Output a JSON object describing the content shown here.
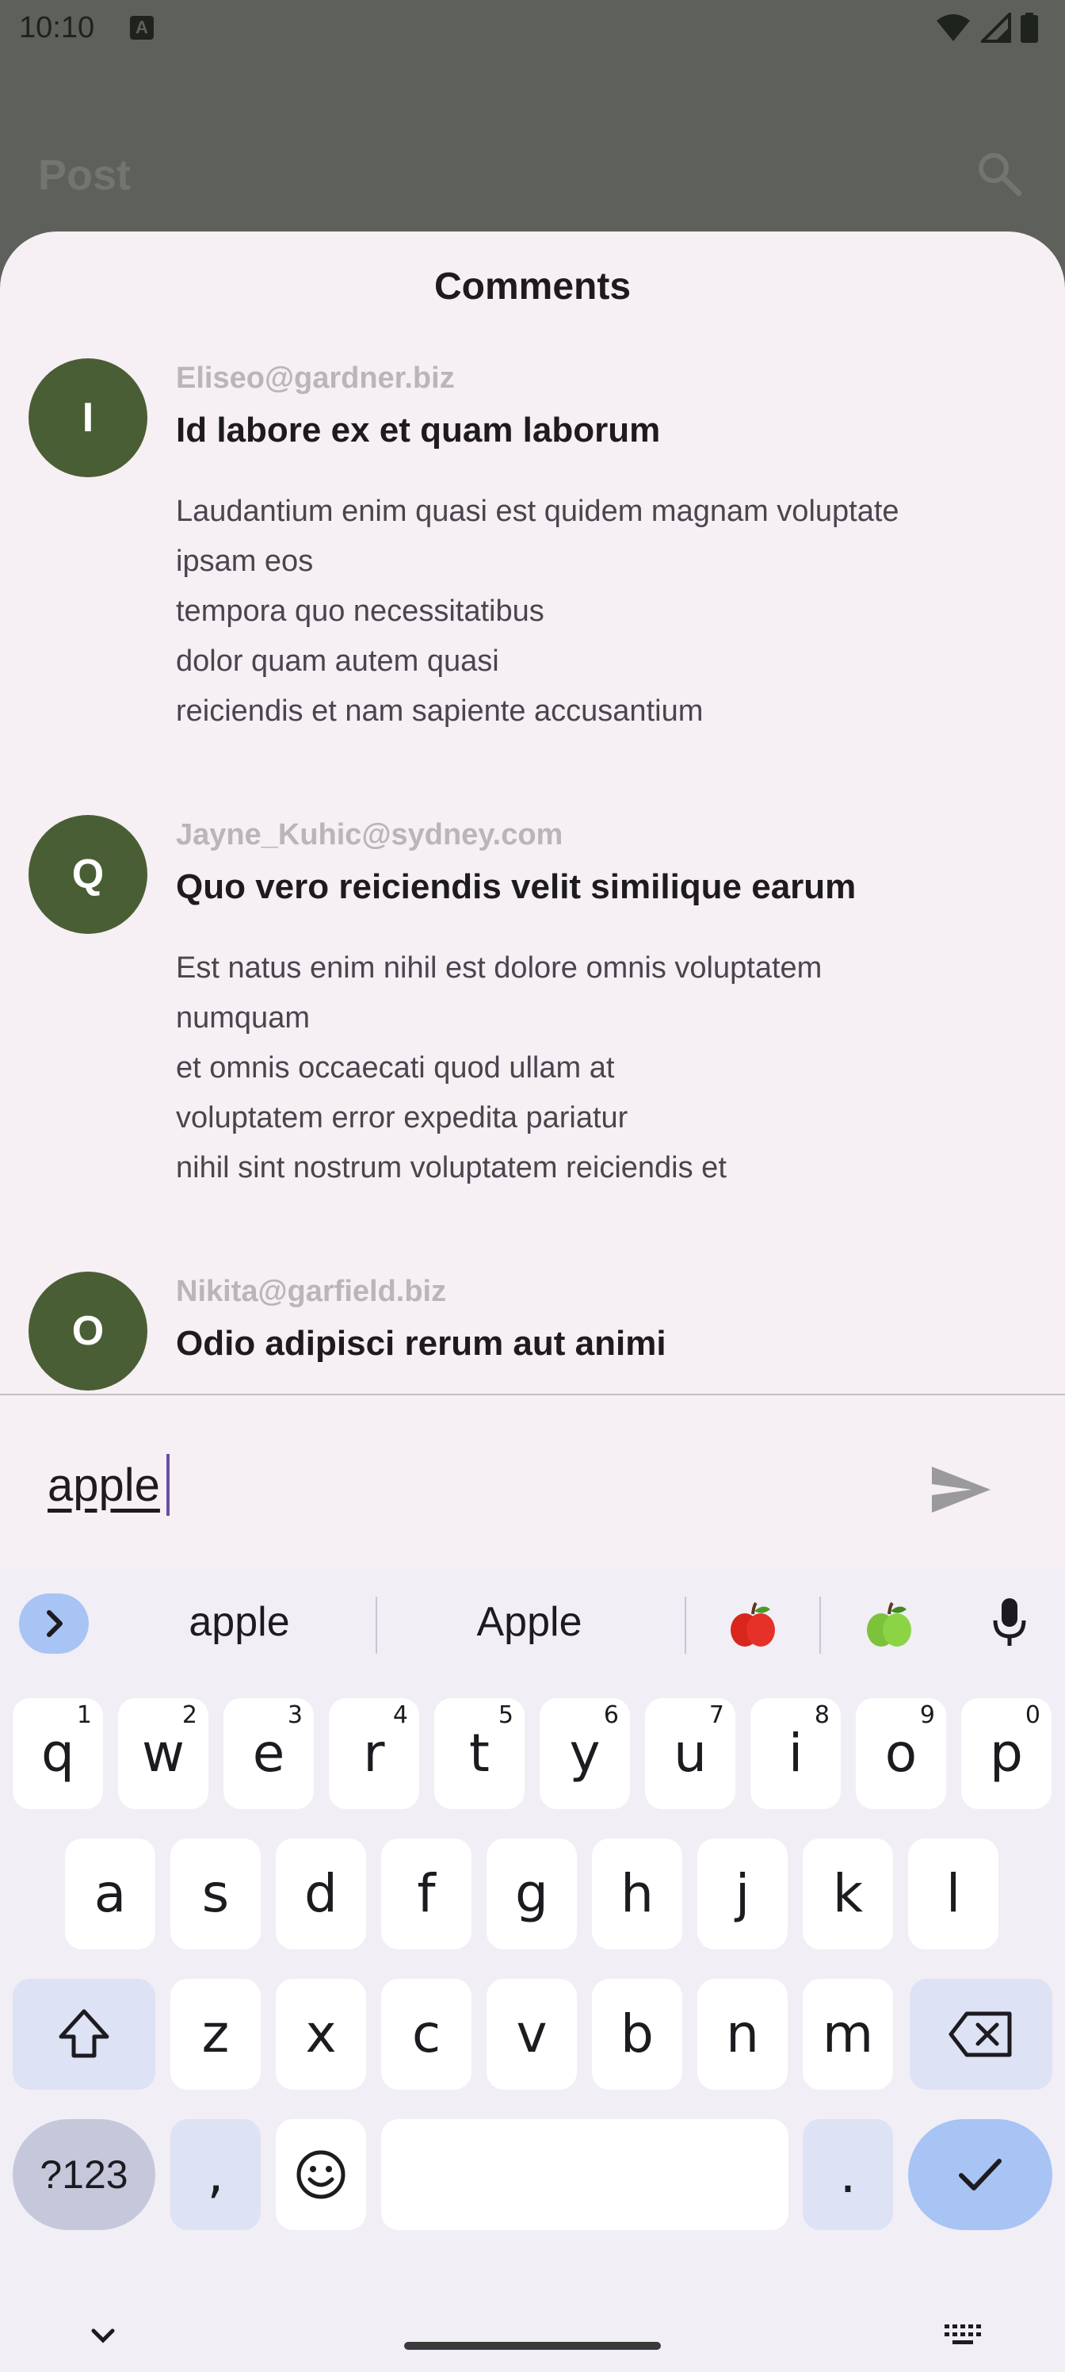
{
  "status_bar": {
    "time": "10:10",
    "notification_icon": "a-box-icon",
    "icons": [
      "wifi-icon",
      "signal-icon",
      "battery-icon"
    ]
  },
  "app_bar": {
    "title": "Post",
    "search_icon": "search-icon"
  },
  "sheet": {
    "title": "Comments",
    "comments": [
      {
        "initial": "I",
        "email": "Eliseo@gardner.biz",
        "title": "Id labore ex et quam laborum",
        "body": "Laudantium enim quasi est quidem magnam voluptate\nipsam eos\ntempora quo necessitatibus\ndolor quam autem quasi\nreiciendis et nam sapiente accusantium"
      },
      {
        "initial": "Q",
        "email": "Jayne_Kuhic@sydney.com",
        "title": "Quo vero reiciendis velit similique earum",
        "body": "Est natus enim nihil est dolore omnis voluptatem\nnumquam\net omnis occaecati quod ullam at\nvoluptatem error expedita pariatur\nnihil sint nostrum voluptatem reiciendis et"
      },
      {
        "initial": "O",
        "email": "Nikita@garfield.biz",
        "title": "Odio adipisci rerum aut animi",
        "body": ""
      }
    ],
    "input_value": "apple",
    "send_icon": "send-icon"
  },
  "keyboard": {
    "suggestions": [
      "apple",
      "Apple"
    ],
    "emoji_suggestions": [
      "red-apple-emoji",
      "green-apple-emoji"
    ],
    "row1": [
      {
        "k": "q",
        "h": "1"
      },
      {
        "k": "w",
        "h": "2"
      },
      {
        "k": "e",
        "h": "3"
      },
      {
        "k": "r",
        "h": "4"
      },
      {
        "k": "t",
        "h": "5"
      },
      {
        "k": "y",
        "h": "6"
      },
      {
        "k": "u",
        "h": "7"
      },
      {
        "k": "i",
        "h": "8"
      },
      {
        "k": "o",
        "h": "9"
      },
      {
        "k": "p",
        "h": "0"
      }
    ],
    "row2": [
      "a",
      "s",
      "d",
      "f",
      "g",
      "h",
      "j",
      "k",
      "l"
    ],
    "row3": [
      "z",
      "x",
      "c",
      "v",
      "b",
      "n",
      "m"
    ],
    "symbols_label": "?123",
    "comma": ",",
    "period": ".",
    "colors": {
      "accent": "#a8c4f4",
      "func_key": "#dde2f4",
      "avatar": "#4a5e35"
    }
  }
}
